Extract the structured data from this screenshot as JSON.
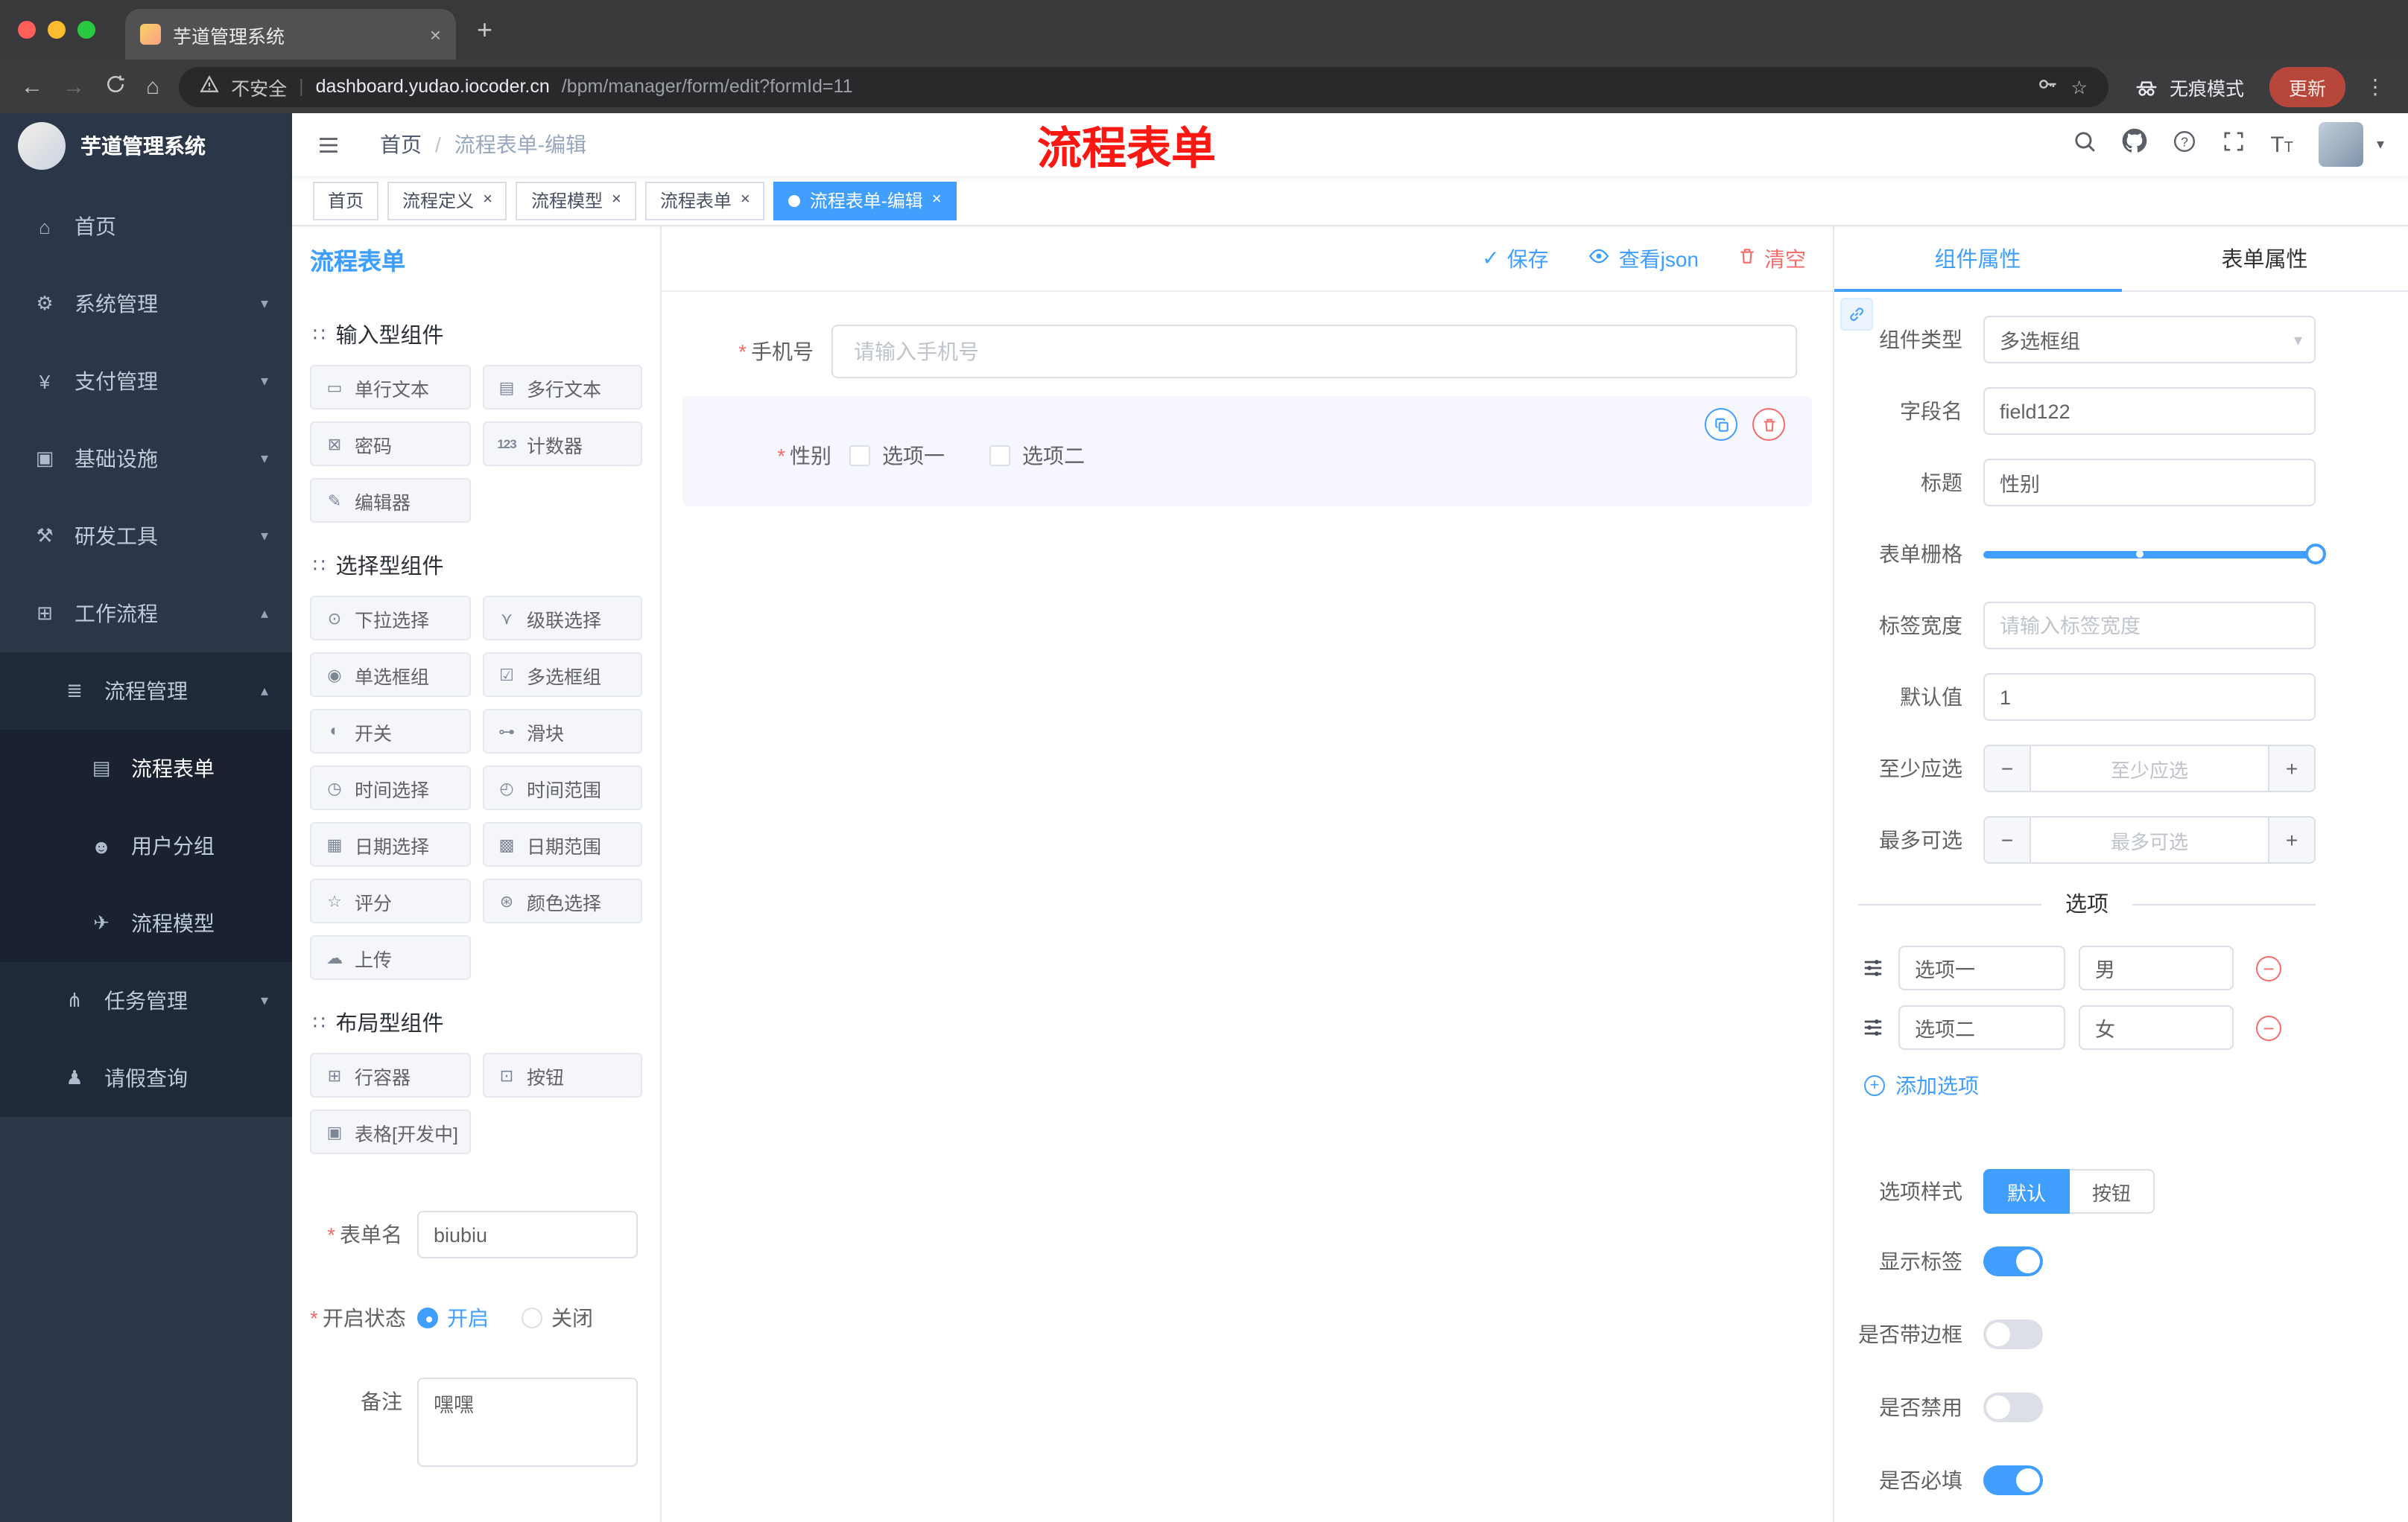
{
  "browser": {
    "tab_title": "芋道管理系统",
    "new_tab": "+",
    "security": "不安全",
    "url_host": "dashboard.yudao.iocoder.cn",
    "url_path": "/bpm/manager/form/edit?formId=11",
    "incognito": "无痕模式",
    "update": "更新"
  },
  "annotation": "流程表单",
  "sidebar": {
    "logo": "芋道管理系统",
    "menu": [
      {
        "icon": "⌂",
        "label": "首页"
      },
      {
        "icon": "⚙",
        "label": "系统管理",
        "chev": "▾"
      },
      {
        "icon": "¥",
        "label": "支付管理",
        "chev": "▾"
      },
      {
        "icon": "▣",
        "label": "基础设施",
        "chev": "▾"
      },
      {
        "icon": "⚒",
        "label": "研发工具",
        "chev": "▾"
      },
      {
        "icon": "⊞",
        "label": "工作流程",
        "chev": "▴"
      },
      {
        "icon": "≣",
        "label": "流程管理",
        "chev": "▴"
      },
      {
        "icon": "▤",
        "label": "流程表单"
      },
      {
        "icon": "☻",
        "label": "用户分组"
      },
      {
        "icon": "✈",
        "label": "流程模型"
      },
      {
        "icon": "⋔",
        "label": "任务管理",
        "chev": "▾"
      },
      {
        "icon": "♟",
        "label": "请假查询"
      }
    ]
  },
  "navbar": {
    "crumb1": "首页",
    "crumb2": "流程表单-编辑"
  },
  "tags": {
    "t0": "首页",
    "t1": "流程定义",
    "t2": "流程模型",
    "t3": "流程表单",
    "t4": "流程表单-编辑"
  },
  "palette": {
    "title": "流程表单",
    "g1_title": "输入型组件",
    "g1": [
      {
        "icon": "▭",
        "label": "单行文本"
      },
      {
        "icon": "▤",
        "label": "多行文本"
      },
      {
        "icon": "⊠",
        "label": "密码"
      },
      {
        "icon": "123",
        "label": "计数器"
      },
      {
        "icon": "✎",
        "label": "编辑器"
      }
    ],
    "g2_title": "选择型组件",
    "g2": [
      {
        "icon": "⊙",
        "label": "下拉选择"
      },
      {
        "icon": "⋎",
        "label": "级联选择"
      },
      {
        "icon": "◉",
        "label": "单选框组"
      },
      {
        "icon": "☑",
        "label": "多选框组"
      },
      {
        "icon": "◐",
        "label": "开关"
      },
      {
        "icon": "⊶",
        "label": "滑块"
      },
      {
        "icon": "◷",
        "label": "时间选择"
      },
      {
        "icon": "◴",
        "label": "时间范围"
      },
      {
        "icon": "▦",
        "label": "日期选择"
      },
      {
        "icon": "▩",
        "label": "日期范围"
      },
      {
        "icon": "☆",
        "label": "评分"
      },
      {
        "icon": "⊛",
        "label": "颜色选择"
      },
      {
        "icon": "☁",
        "label": "上传"
      }
    ],
    "g3_title": "布局型组件",
    "g3": [
      {
        "icon": "⊞",
        "label": "行容器"
      },
      {
        "icon": "⊡",
        "label": "按钮"
      },
      {
        "icon": "▣",
        "label": "表格[开发中]"
      }
    ],
    "form": {
      "name_label": "表单名",
      "name_value": "biubiu",
      "status_label": "开启状态",
      "on": "开启",
      "off": "关闭",
      "remark_label": "备注",
      "remark_value": "嘿嘿"
    }
  },
  "canvas": {
    "save": "保存",
    "view_json": "查看json",
    "clear": "清空",
    "phone_label": "手机号",
    "phone_placeholder": "请输入手机号",
    "gender_label": "性别",
    "opt1": "选项一",
    "opt2": "选项二"
  },
  "props": {
    "tab1": "组件属性",
    "tab2": "表单属性",
    "type_label": "组件类型",
    "type_value": "多选框组",
    "field_label": "字段名",
    "field_value": "field122",
    "title_label": "标题",
    "title_value": "性别",
    "grid_label": "表单栅格",
    "width_label": "标签宽度",
    "width_placeholder": "请输入标签宽度",
    "default_label": "默认值",
    "default_value": "1",
    "min_label": "至少应选",
    "min_placeholder": "至少应选",
    "max_label": "最多可选",
    "max_placeholder": "最多可选",
    "options_title": "选项",
    "opt_rows": [
      {
        "name": "选项一",
        "value": "男"
      },
      {
        "name": "选项二",
        "value": "女"
      }
    ],
    "add_option": "添加选项",
    "style_label": "选项样式",
    "style_default": "默认",
    "style_button": "按钮",
    "sw1": "显示标签",
    "sw2": "是否带边框",
    "sw3": "是否禁用",
    "sw4": "是否必填"
  },
  "colors": {
    "primary": "#409eff",
    "danger": "#f56c6c",
    "annotation_red": "#fb1712",
    "sidebar_bg": "#2b3648"
  }
}
